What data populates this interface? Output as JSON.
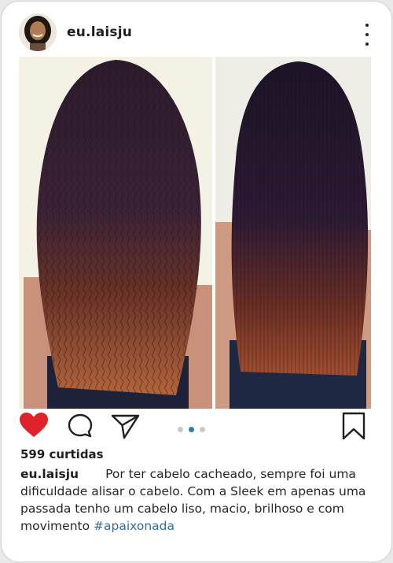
{
  "post": {
    "username": "eu.laisju",
    "likes": "599 curtidas",
    "caption_author": "eu.laisju",
    "caption_text": "Por ter cabelo cacheado, sempre foi uma dificuldade alisar o cabelo. Com a Sleek em apenas uma passada tenho um cabelo liso, macio, brilhoso e com movimento ",
    "hashtag": "#apaixonada",
    "liked": true,
    "carousel": {
      "count": 3,
      "active_index": 1
    }
  },
  "icons": {
    "more": "more-vertical-icon",
    "like": "heart-filled-icon",
    "comment": "comment-bubble-icon",
    "share": "paper-plane-icon",
    "save": "bookmark-icon"
  },
  "colors": {
    "like": "#e0222a",
    "link": "#2e6fa3",
    "dot_active": "#2e7db2",
    "dot_inactive": "#c9c9c9"
  }
}
